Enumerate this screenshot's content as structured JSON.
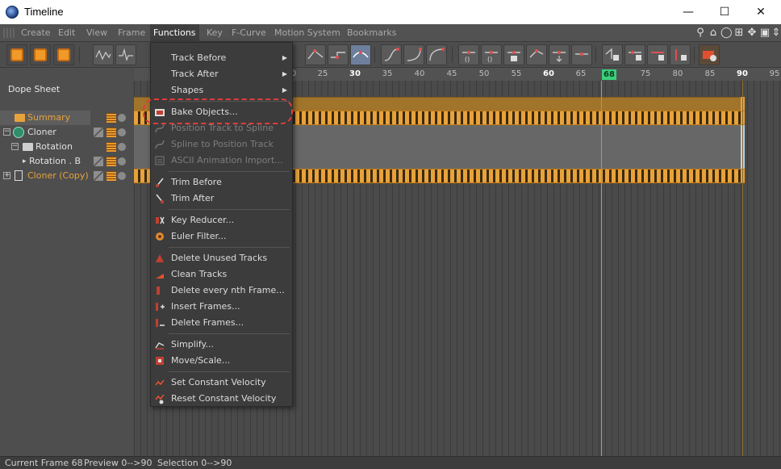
{
  "window": {
    "title": "Timeline",
    "controls": [
      "minimize-icon",
      "maximize-icon",
      "close-icon"
    ]
  },
  "menubar": {
    "items": [
      "Create",
      "Edit",
      "View",
      "Frame",
      "Functions",
      "Key",
      "F-Curve",
      "Motion System",
      "Bookmarks"
    ],
    "active": "Functions",
    "right_icons": [
      "search-icon",
      "home-icon",
      "link-icon",
      "plus-icon",
      "move-icon",
      "layout-icon",
      "arrows-icon"
    ]
  },
  "left_panel": {
    "header": "Dope Sheet",
    "tree": [
      {
        "label": "Summary"
      },
      {
        "label": "Cloner"
      },
      {
        "label": "Rotation"
      },
      {
        "label": "Rotation . B"
      },
      {
        "label": "Cloner (Copy)"
      }
    ]
  },
  "ruler": {
    "ticks": [
      "0",
      "25",
      "30",
      "35",
      "40",
      "45",
      "50",
      "55",
      "60",
      "65",
      "68",
      "75",
      "80",
      "85",
      "90",
      "95"
    ],
    "bold_ticks": [
      "30",
      "60",
      "90"
    ],
    "current_frame_label": "68"
  },
  "context_menu": {
    "items": [
      {
        "label": "Track Before",
        "submenu": true,
        "enabled": true,
        "icon": ""
      },
      {
        "label": "Track After",
        "submenu": true,
        "enabled": true,
        "icon": ""
      },
      {
        "label": "Shapes",
        "submenu": true,
        "enabled": true,
        "icon": ""
      },
      {
        "label": "Bake Objects...",
        "enabled": true,
        "icon": "bake-icon",
        "highlighted": true
      },
      {
        "label": "Position Track to Spline",
        "enabled": false,
        "icon": "spline-icon"
      },
      {
        "label": "Spline to Position Track",
        "enabled": false,
        "icon": "spline-icon"
      },
      {
        "label": "ASCII Animation Import...",
        "enabled": false,
        "icon": "ascii-icon"
      },
      {
        "label": "Trim Before",
        "enabled": true,
        "icon": "trim-icon"
      },
      {
        "label": "Trim After",
        "enabled": true,
        "icon": "trim-icon"
      },
      {
        "label": "Key Reducer...",
        "enabled": true,
        "icon": "key-reducer-icon"
      },
      {
        "label": "Euler Filter...",
        "enabled": true,
        "icon": "euler-icon"
      },
      {
        "label": "Delete Unused Tracks",
        "enabled": true,
        "icon": "delete-tracks-icon"
      },
      {
        "label": "Clean Tracks",
        "enabled": true,
        "icon": "clean-icon"
      },
      {
        "label": "Delete every nth Frame...",
        "enabled": true,
        "icon": "nth-frame-icon"
      },
      {
        "label": "Insert Frames...",
        "enabled": true,
        "icon": "insert-frames-icon"
      },
      {
        "label": "Delete Frames...",
        "enabled": true,
        "icon": "delete-frames-icon"
      },
      {
        "label": "Simplify...",
        "enabled": true,
        "icon": "simplify-icon"
      },
      {
        "label": "Move/Scale...",
        "enabled": true,
        "icon": "move-scale-icon"
      },
      {
        "label": "Set Constant Velocity",
        "enabled": true,
        "icon": "velocity-icon"
      },
      {
        "label": "Reset Constant Velocity",
        "enabled": true,
        "icon": "velocity-reset-icon"
      }
    ]
  },
  "status_bar": {
    "current_frame": "Current Frame  68",
    "preview": "Preview  0-->90",
    "selection": "Selection 0-->90"
  },
  "colors": {
    "accent_orange": "#e8a23c",
    "playhead": "#3ad07a",
    "highlight_ring": "#e03c3c"
  }
}
